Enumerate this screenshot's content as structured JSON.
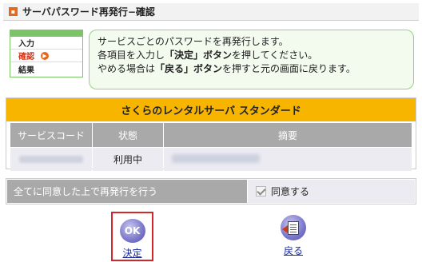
{
  "header": {
    "title": "サーバパスワード再発行−確認",
    "icon": "orange-square-icon"
  },
  "steps": [
    {
      "label": "入力",
      "active": false
    },
    {
      "label": "確認",
      "active": true
    },
    {
      "label": "結果",
      "active": false
    }
  ],
  "info": {
    "line1": "サービスごとのパスワードを再発行します。",
    "line2_pre": "各項目を入力し",
    "line2_bold": "「決定」ボタン",
    "line2_post": "を押してください。",
    "line3_pre": "やめる場合は",
    "line3_bold": "「戻る」ボタン",
    "line3_post": "を押すと元の画面に戻ります。"
  },
  "panel": {
    "title": "さくらのレンタルサーバ スタンダード",
    "headers": [
      "サービスコード",
      "状態",
      "摘要"
    ],
    "row": {
      "status": "利用中"
    }
  },
  "agree": {
    "label": "全てに同意した上で再発行を行う",
    "checkbox_label": "同意する",
    "checked": true
  },
  "buttons": {
    "ok_icon_text": "OK",
    "ok_label": "決定",
    "back_label": "戻る"
  },
  "colors": {
    "accent_orange": "#f7b500",
    "header_gray": "#a9a9a9",
    "cell_bg": "#ecebf2",
    "info_bg": "#f2fbee",
    "step_green": "#7cc36a",
    "highlight_red": "#d7262a"
  }
}
